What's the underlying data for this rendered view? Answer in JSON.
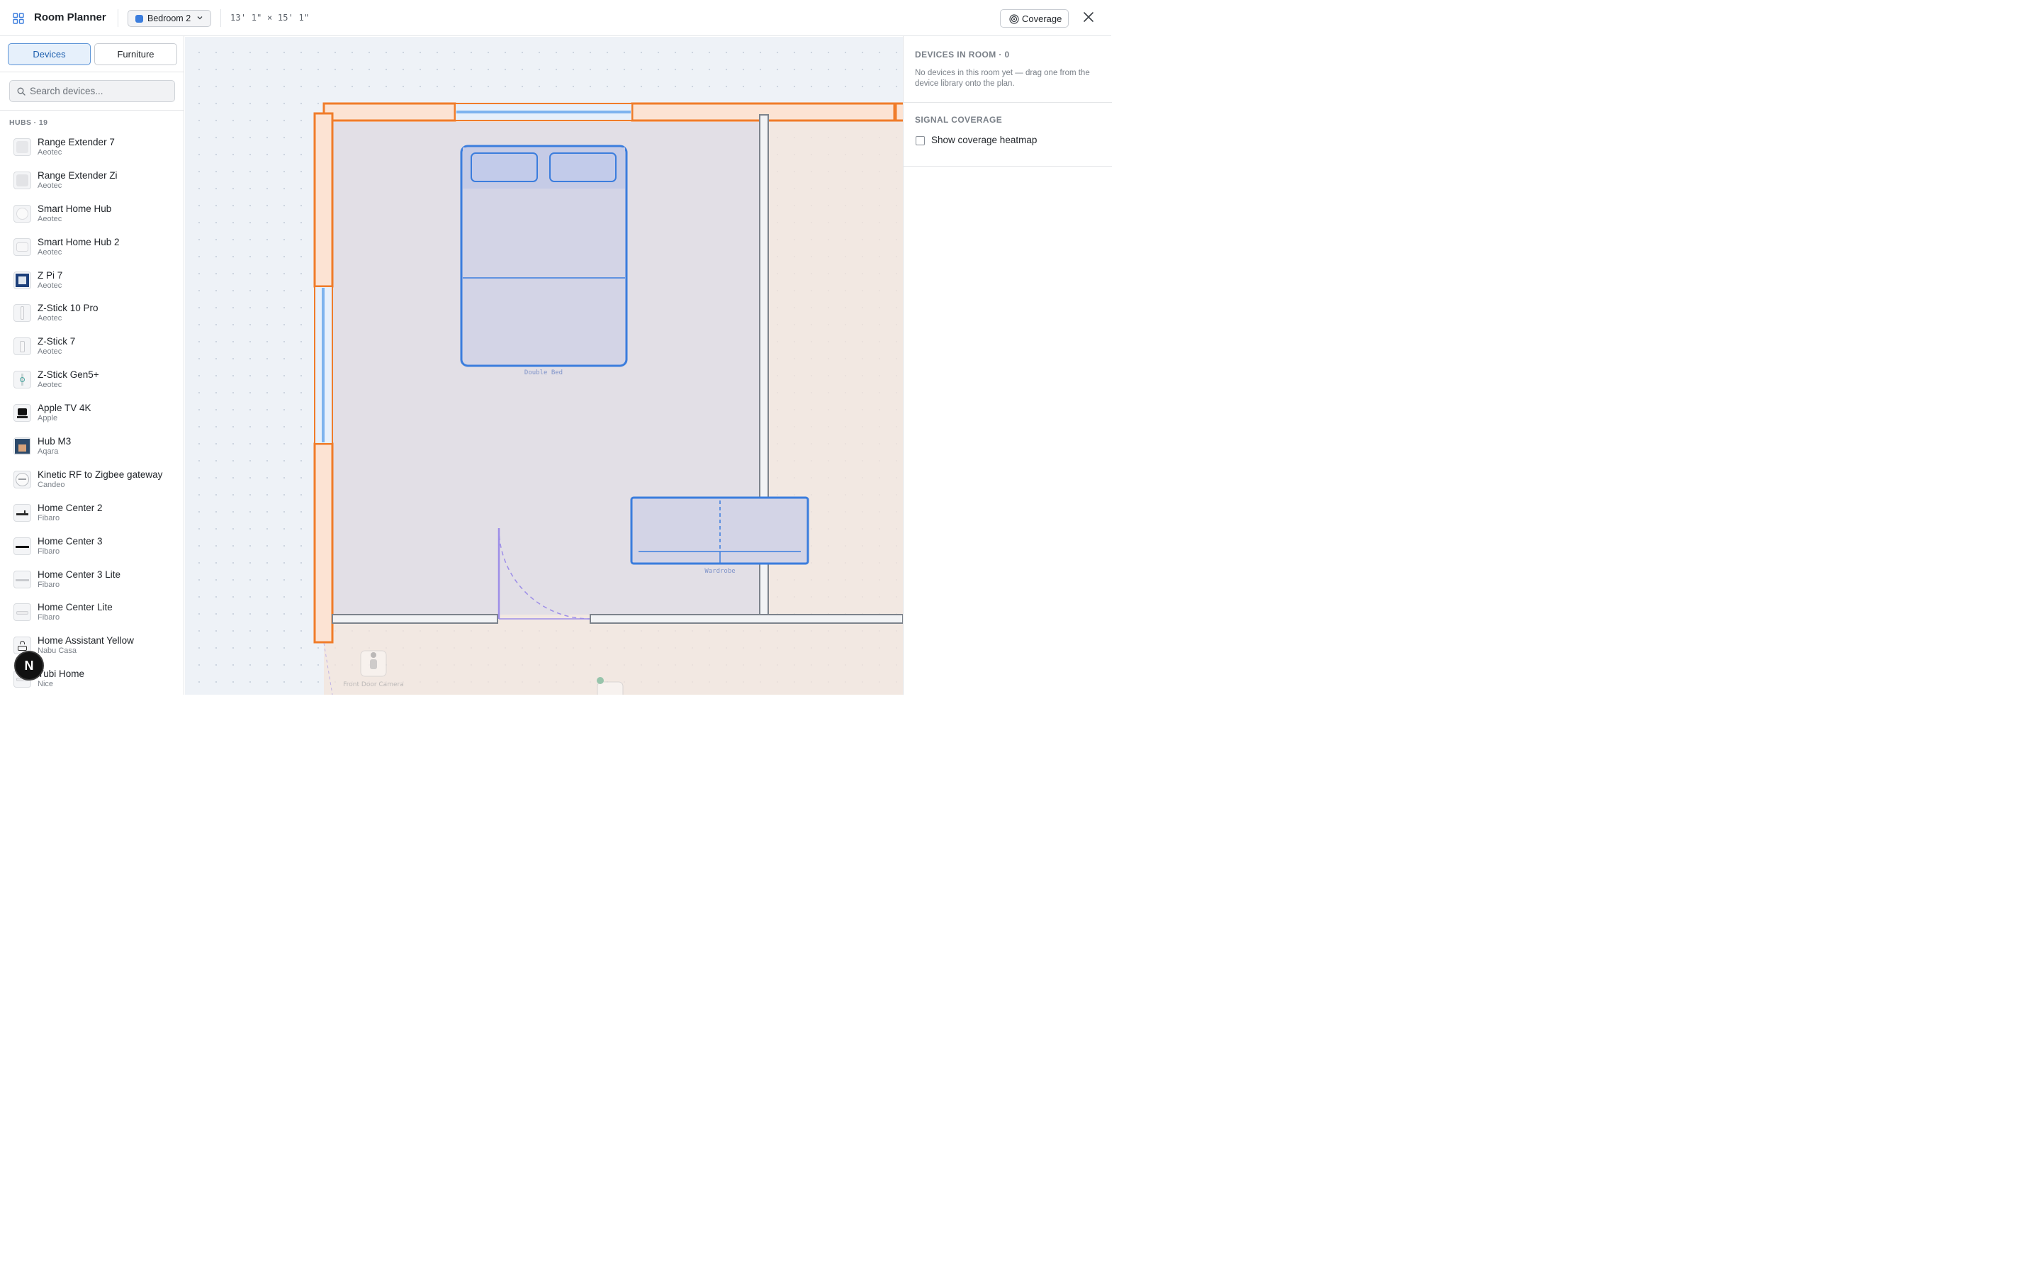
{
  "app": {
    "title": "Room Planner",
    "room_selector": {
      "value": "Bedroom 2",
      "color": "#3b7ddd"
    },
    "dimensions": "13' 1\" × 15' 1\"",
    "coverage_button": "Coverage"
  },
  "sidebar": {
    "tabs": [
      {
        "label": "Devices",
        "active": true
      },
      {
        "label": "Furniture",
        "active": false
      }
    ],
    "search": {
      "placeholder": "Search devices...",
      "value": ""
    },
    "section_label": "HUBS · 19",
    "devices": [
      {
        "name": "Range Extender 7",
        "brand": "Aeotec"
      },
      {
        "name": "Range Extender Zi",
        "brand": "Aeotec"
      },
      {
        "name": "Smart Home Hub",
        "brand": "Aeotec"
      },
      {
        "name": "Smart Home Hub 2",
        "brand": "Aeotec"
      },
      {
        "name": "Z Pi 7",
        "brand": "Aeotec"
      },
      {
        "name": "Z-Stick 10 Pro",
        "brand": "Aeotec"
      },
      {
        "name": "Z-Stick 7",
        "brand": "Aeotec"
      },
      {
        "name": "Z-Stick Gen5+",
        "brand": "Aeotec"
      },
      {
        "name": "Apple TV 4K",
        "brand": "Apple"
      },
      {
        "name": "Hub M3",
        "brand": "Aqara"
      },
      {
        "name": "Kinetic RF to Zigbee gateway",
        "brand": "Candeo"
      },
      {
        "name": "Home Center 2",
        "brand": "Fibaro"
      },
      {
        "name": "Home Center 3",
        "brand": "Fibaro"
      },
      {
        "name": "Home Center 3 Lite",
        "brand": "Fibaro"
      },
      {
        "name": "Home Center Lite",
        "brand": "Fibaro"
      },
      {
        "name": "Home Assistant Yellow",
        "brand": "Nabu Casa"
      },
      {
        "name": "Yubi Home",
        "brand": "Nice"
      }
    ],
    "badge": "N"
  },
  "plan": {
    "furniture": [
      {
        "label": "Double Bed"
      },
      {
        "label": "Wardrobe"
      }
    ],
    "outside_device_label": "Front Door Camera",
    "colors": {
      "wall": "#f07c2a",
      "wall_fill": "#fce3d3",
      "furniture": "#3b7ddd",
      "window": "#7eb3ee",
      "door": "#9d8ee8"
    }
  },
  "right_panel": {
    "devices_heading": "DEVICES IN ROOM · 0",
    "empty_text": "No devices in this room yet — drag one from the device library onto the plan.",
    "coverage_heading": "SIGNAL COVERAGE",
    "heatmap_label": "Show coverage heatmap",
    "heatmap_checked": false
  }
}
